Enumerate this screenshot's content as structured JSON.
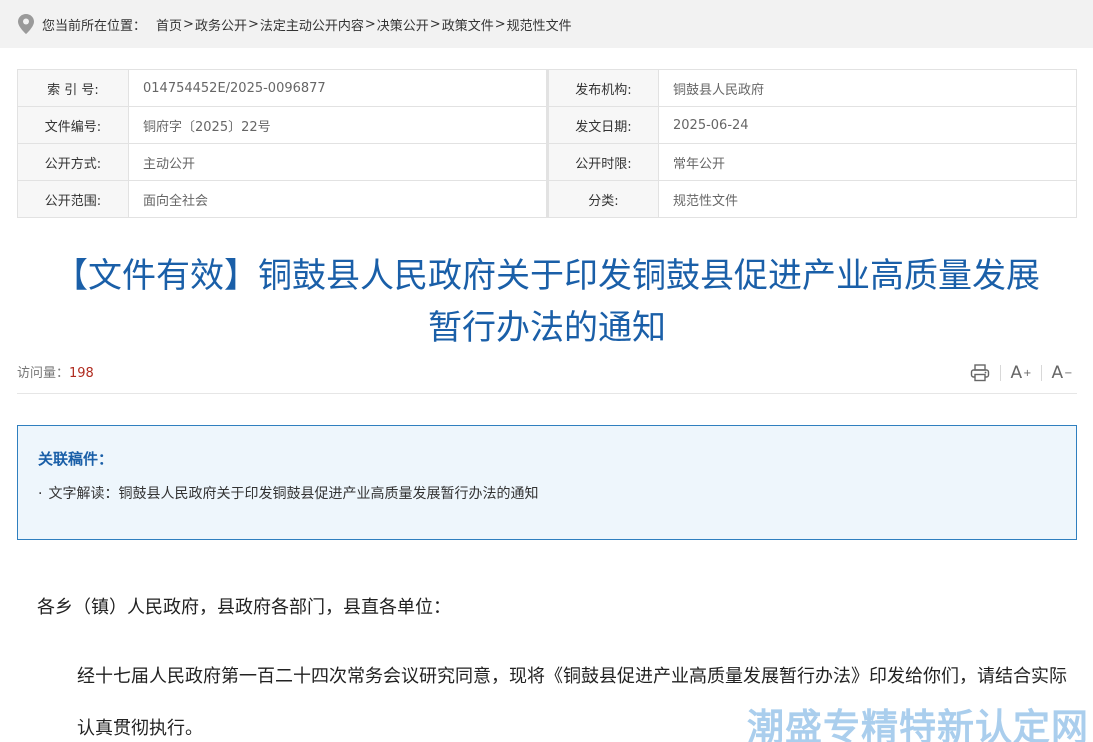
{
  "breadcrumb": {
    "label": "您当前所在位置：",
    "items": [
      "首页",
      "政务公开",
      "法定主动公开内容",
      "决策公开",
      "政策文件",
      "规范性文件"
    ],
    "separator": ">"
  },
  "meta": {
    "index_label": "索 引 号:",
    "index_value": "014754452E/2025-0096877",
    "publisher_label": "发布机构:",
    "publisher_value": "铜鼓县人民政府",
    "docno_label": "文件编号:",
    "docno_value": "铜府字〔2025〕22号",
    "date_label": "发文日期:",
    "date_value": "2025-06-24",
    "mode_label": "公开方式:",
    "mode_value": "主动公开",
    "term_label": "公开时限:",
    "term_value": "常年公开",
    "scope_label": "公开范围:",
    "scope_value": "面向全社会",
    "category_label": "分类:",
    "category_value": "规范性文件"
  },
  "title": {
    "line1": "【文件有效】铜鼓县人民政府关于印发铜鼓县促进产业高质量发展",
    "line2": "暂行办法的通知"
  },
  "stats": {
    "visits_label": "访问量：",
    "visits_count": "198",
    "print_icon": "printer-icon",
    "font_increase": "A",
    "font_decrease": "A"
  },
  "related": {
    "title": "关联稿件：",
    "bullet": "·",
    "item": "文字解读：铜鼓县人民政府关于印发铜鼓县促进产业高质量发展暂行办法的通知"
  },
  "body": {
    "greeting": "各乡（镇）人民政府，县政府各部门，县直各单位：",
    "paragraph": "经十七届人民政府第一百二十四次常务会议研究同意，现将《铜鼓县促进产业高质量发展暂行办法》印发给你们，请结合实际认真贯彻执行。"
  },
  "watermark": "潮盛专精特新认定网",
  "colors": {
    "title_blue": "#1a5fa8",
    "visits_red": "#b02b1f",
    "related_border": "#2f7fbf",
    "related_bg": "#eef6fc"
  }
}
